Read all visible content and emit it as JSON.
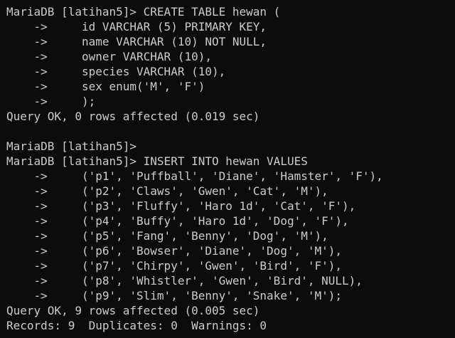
{
  "colors": {
    "background": "#0c0c0c",
    "foreground": "#cccccc"
  },
  "terminal": {
    "lines": [
      "MariaDB [latihan5]> CREATE TABLE hewan (",
      "    ->     id VARCHAR (5) PRIMARY KEY,",
      "    ->     name VARCHAR (10) NOT NULL,",
      "    ->     owner VARCHAR (10),",
      "    ->     species VARCHAR (10),",
      "    ->     sex enum('M', 'F')",
      "    ->     );",
      "Query OK, 0 rows affected (0.019 sec)",
      "",
      "MariaDB [latihan5]>",
      "MariaDB [latihan5]> INSERT INTO hewan VALUES",
      "    ->     ('p1', 'Puffball', 'Diane', 'Hamster', 'F'),",
      "    ->     ('p2', 'Claws', 'Gwen', 'Cat', 'M'),",
      "    ->     ('p3', 'Fluffy', 'Haro 1d', 'Cat', 'F'),",
      "    ->     ('p4', 'Buffy', 'Haro 1d', 'Dog', 'F'),",
      "    ->     ('p5', 'Fang', 'Benny', 'Dog', 'M'),",
      "    ->     ('p6', 'Bowser', 'Diane', 'Dog', 'M'),",
      "    ->     ('p7', 'Chirpy', 'Gwen', 'Bird', 'F'),",
      "    ->     ('p8', 'Whistler', 'Gwen', 'Bird', NULL),",
      "    ->     ('p9', 'Slim', 'Benny', 'Snake', 'M');",
      "Query OK, 9 rows affected (0.005 sec)",
      "Records: 9  Duplicates: 0  Warnings: 0"
    ]
  }
}
